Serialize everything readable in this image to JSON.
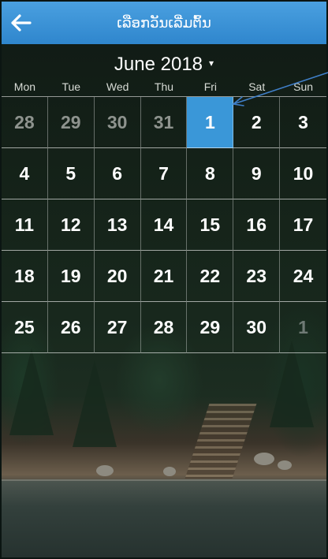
{
  "header": {
    "title": "ເລືອກວັນເລີ່ມຕົ້ນ",
    "back_icon": "arrow-left-icon"
  },
  "calendar": {
    "month_label": "June 2018",
    "dropdown_caret": "▾",
    "weekdays": [
      "Mon",
      "Tue",
      "Wed",
      "Thu",
      "Fri",
      "Sat",
      "Sun"
    ],
    "weeks": [
      [
        "28",
        "29",
        "30",
        "31",
        "1",
        "2",
        "3"
      ],
      [
        "4",
        "5",
        "6",
        "7",
        "8",
        "9",
        "10"
      ],
      [
        "11",
        "12",
        "13",
        "14",
        "15",
        "16",
        "17"
      ],
      [
        "18",
        "19",
        "20",
        "21",
        "22",
        "23",
        "24"
      ],
      [
        "25",
        "26",
        "27",
        "28",
        "29",
        "30",
        "1"
      ]
    ],
    "selected_day": "1"
  },
  "colors": {
    "header_top": "#4aa0e0",
    "header_bottom": "#2f86cd",
    "selected_cell": "#3a97d8",
    "annotation_arrow": "#3f7fc8"
  }
}
